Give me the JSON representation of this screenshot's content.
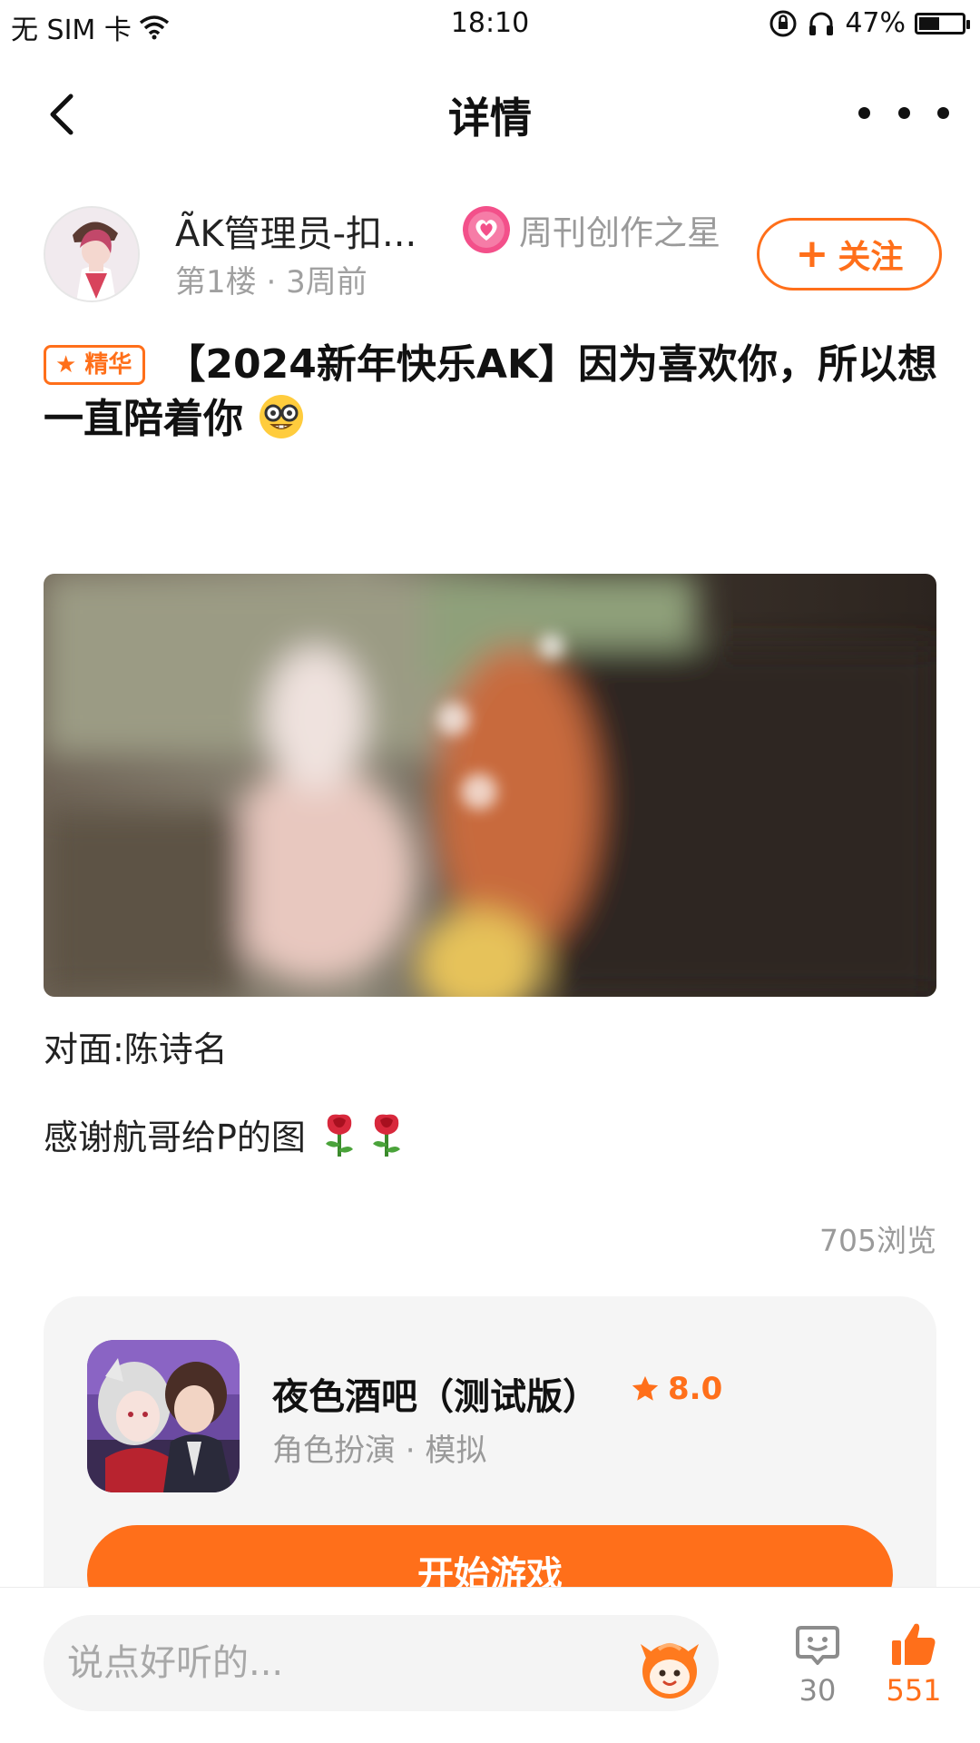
{
  "status_bar": {
    "carrier": "无 SIM 卡",
    "time": "18:10",
    "battery": "47%",
    "battery_level": 0.47
  },
  "nav": {
    "title": "详情",
    "back_icon": "chevron-left-icon",
    "more_icon": "more-dots-icon"
  },
  "author": {
    "name": "A͂K管理员-扣...",
    "badge": "周刊创作之星",
    "floor": "第1楼",
    "time": "3周前",
    "follow_label": "关注"
  },
  "post": {
    "essence_tag": "精华",
    "title": "【2024新年快乐AK】因为喜欢你，所以想一直陪着你",
    "line1": "对面:陈诗名",
    "line2": "感谢航哥给P的图",
    "views": "705浏览"
  },
  "game": {
    "name": "夜色酒吧（测试版）",
    "rating": "8.0",
    "tags": "角色扮演 · 模拟",
    "play_label": "开始游戏"
  },
  "bottom": {
    "placeholder": "说点好听的...",
    "comments": "30",
    "likes": "551"
  },
  "colors": {
    "accent": "#ff6f1a",
    "muted": "#9a9a9a"
  }
}
